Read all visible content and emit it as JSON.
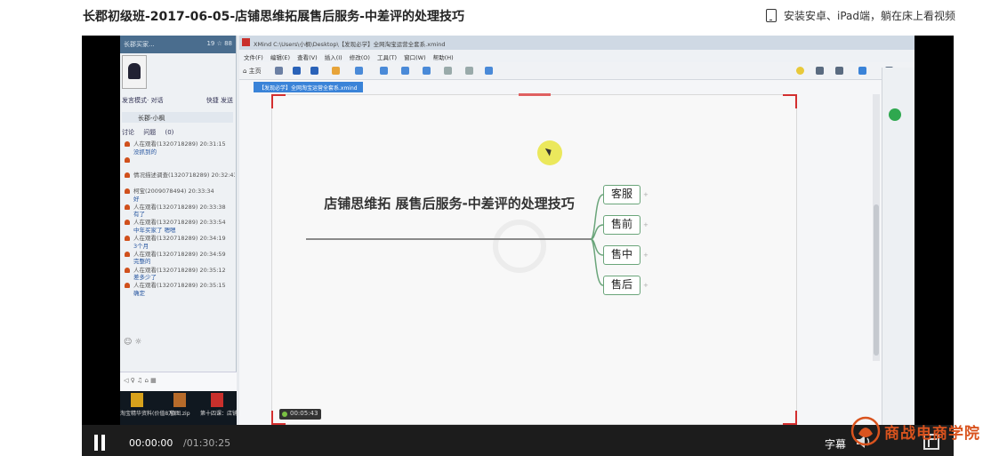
{
  "page": {
    "title": "长郡初级班-2017-06-05-店铺思维拓展售后服务-中差评的处理技巧",
    "mobile_promo": "安装安卓、iPad端，躺在床上看视频"
  },
  "recording": {
    "chat": {
      "header_left": "长郡买家...",
      "header_right": "19 ☆ 88",
      "mode_label": "发言模式",
      "mode_value": "· 对话",
      "mode_right": "快捷   发送",
      "user": "长郡-小枫",
      "tabs": [
        "讨论",
        "问题",
        "(0)"
      ],
      "messages": [
        {
          "meta": "人在观看(1320718289) 20:31:15",
          "text": "没抓到的"
        },
        {
          "meta": "",
          "text": ""
        },
        {
          "meta": "情况描述调查(1320718289) 20:32:43",
          "text": ""
        },
        {
          "meta": "柯宝(2009078494) 20:33:34",
          "text": "好"
        },
        {
          "meta": "人在观看(1320718289) 20:33:38",
          "text": "有了"
        },
        {
          "meta": "人在观看(1320718289) 20:33:54",
          "text": "中年买家了 嗯嗯"
        },
        {
          "meta": "人在观看(1320718289) 20:34:19",
          "text": "3个月"
        },
        {
          "meta": "人在观看(1320718289) 20:34:59",
          "text": "完整的"
        },
        {
          "meta": "人在观看(1320718289) 20:35:12",
          "text": "差多少了"
        },
        {
          "meta": "人在观看(1320718289) 20:35:15",
          "text": "确定"
        }
      ],
      "input_placeholder": "",
      "files": [
        "淘宝精华资料(价值8万)",
        "修图.zip",
        "第十四课：店铺实战训..."
      ]
    },
    "xmind": {
      "window_title": "XMind  C:\\Users\\小枫\\Desktop\\【发现必学】全网淘宝运营全套系.xmind",
      "menu": "文件(F) 编辑(E) 查看(V) 插入(I) 修改(O) 工具(T) 窗口(W) 帮助(H)",
      "toolbar_home": "主页",
      "doc_tab": "【发现必学】全网淘宝运营全套系.xmind",
      "central_topic": "店铺思维拓  展售后服务-中差评的处理技巧",
      "sub_topics": [
        "客服",
        "售前",
        "售中",
        "售后"
      ],
      "rec_timer": "00:05:43"
    }
  },
  "controls": {
    "time_current": "00:00:00",
    "time_total": "/01:30:25",
    "subtitles": "字幕"
  },
  "brand": {
    "name": "商战电商学院"
  }
}
